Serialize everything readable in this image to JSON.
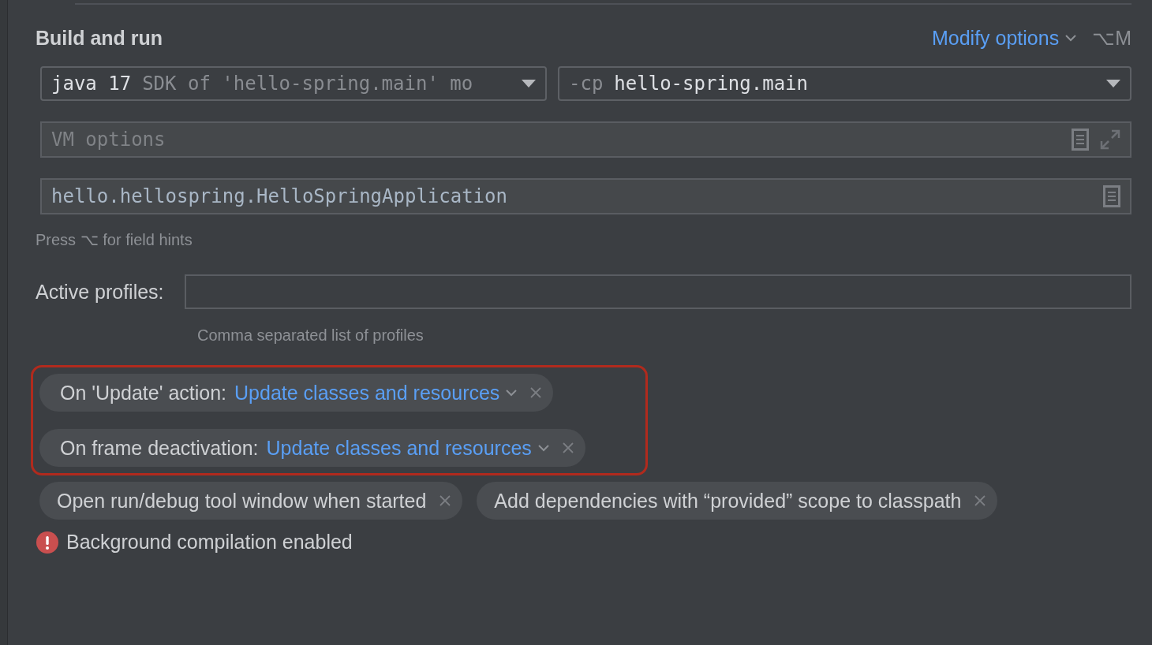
{
  "section": {
    "title": "Build and run"
  },
  "modify_options": {
    "label": "Modify options",
    "shortcut": "⌥M"
  },
  "jre_combo": {
    "value": "java 17",
    "hint": "SDK of 'hello-spring.main' mo"
  },
  "classpath_combo": {
    "prefix": "-cp",
    "value": "hello-spring.main"
  },
  "vm_options": {
    "placeholder": "VM options"
  },
  "main_class": {
    "value": "hello.hellospring.HelloSpringApplication"
  },
  "field_hint": "Press ⌥ for field hints",
  "active_profiles": {
    "label": "Active profiles:",
    "hint": "Comma separated list of profiles"
  },
  "highlighted_options": [
    {
      "label": "On 'Update' action:",
      "value": "Update classes and resources"
    },
    {
      "label": "On frame deactivation:",
      "value": "Update classes and resources"
    }
  ],
  "options": [
    "Open run/debug tool window when started",
    "Add dependencies with “provided” scope to classpath"
  ],
  "warning": {
    "kind": "error",
    "text": "Background compilation enabled"
  }
}
